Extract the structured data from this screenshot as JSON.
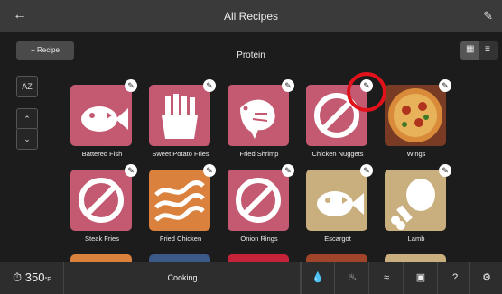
{
  "header": {
    "back_icon": "arrow-left-icon",
    "title": "All Recipes",
    "edit_icon": "pencil-icon"
  },
  "toolbar": {
    "add_recipe_label": "+ Recipe",
    "section_title": "Protein",
    "sort_label": "AZ",
    "view_grid_icon": "grid-icon",
    "view_list_icon": "list-icon"
  },
  "side": {
    "up_icon": "chevron-up-icon",
    "down_icon": "chevron-down-icon"
  },
  "recipes": [
    {
      "name": "Battered Fish"
    },
    {
      "name": "Sweet Potato Fries"
    },
    {
      "name": "Fried Shrimp"
    },
    {
      "name": "Chicken Nuggets"
    },
    {
      "name": "Wings"
    },
    {
      "name": "Steak Fries"
    },
    {
      "name": "Fried Chicken"
    },
    {
      "name": "Onion Rings"
    },
    {
      "name": "Escargot"
    },
    {
      "name": "Lamb"
    }
  ],
  "bottom": {
    "temperature": "350",
    "temperature_unit": "°F",
    "cooking_label": "Cooking"
  },
  "colors": {
    "pink": "#c45a72",
    "orange": "#d9813d",
    "tan": "#c9ae7e",
    "highlight": "#e3121a"
  }
}
